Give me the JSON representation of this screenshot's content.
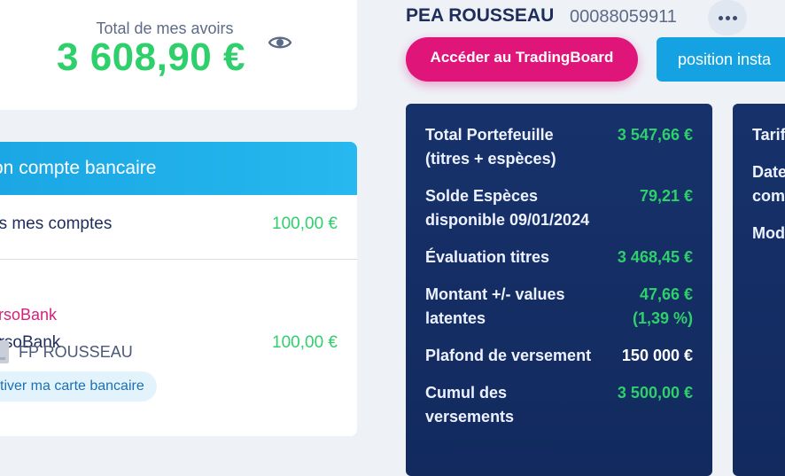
{
  "summary": {
    "total_label": "Total de mes avoirs",
    "total_amount": "3 608,90 €"
  },
  "bank_card": {
    "header": "on compte bancaire",
    "all_accounts_label": "us mes comptes",
    "all_accounts_amount": "100,00 €",
    "account_name": "ursoBank",
    "account_amount": "100,00 €",
    "account_sub": "ursoBank",
    "card_holder": "FP ROUSSEAU",
    "activate_label": "ctiver ma carte bancaire"
  },
  "account": {
    "title": "PEA ROUSSEAU",
    "number": "00088059911"
  },
  "actions": {
    "trading_label": "Accéder au TradingBoard",
    "position_label": "position insta"
  },
  "portfolio": {
    "total_label_1": "Total Portefeuille",
    "total_label_2": "(titres + espèces)",
    "total_value": "3 547,66 €",
    "cash_label_1": "Solde Espèces",
    "cash_label_2": "disponible 09/01/2024",
    "cash_value": "79,21 €",
    "eval_label": "Évaluation titres",
    "eval_value": "3 468,45 €",
    "pl_label_1": "Montant +/- values",
    "pl_label_2": "latentes",
    "pl_value_1": "47,66 €",
    "pl_value_2": "(1,39 %)",
    "cap_label": "Plafond de versement",
    "cap_value": "150 000 €",
    "cumul_label_1": "Cumul des",
    "cumul_label_2": "versements",
    "cumul_value": "3 500,00 €"
  },
  "second_panel": {
    "line1": "Tarif",
    "line2": "Date",
    "line3": "com",
    "line4": "Mod"
  },
  "colors": {
    "accent_green": "#2fcf6c",
    "brand_pink": "#e0157a",
    "brand_blue": "#14a2e2",
    "navy": "#17326b"
  }
}
